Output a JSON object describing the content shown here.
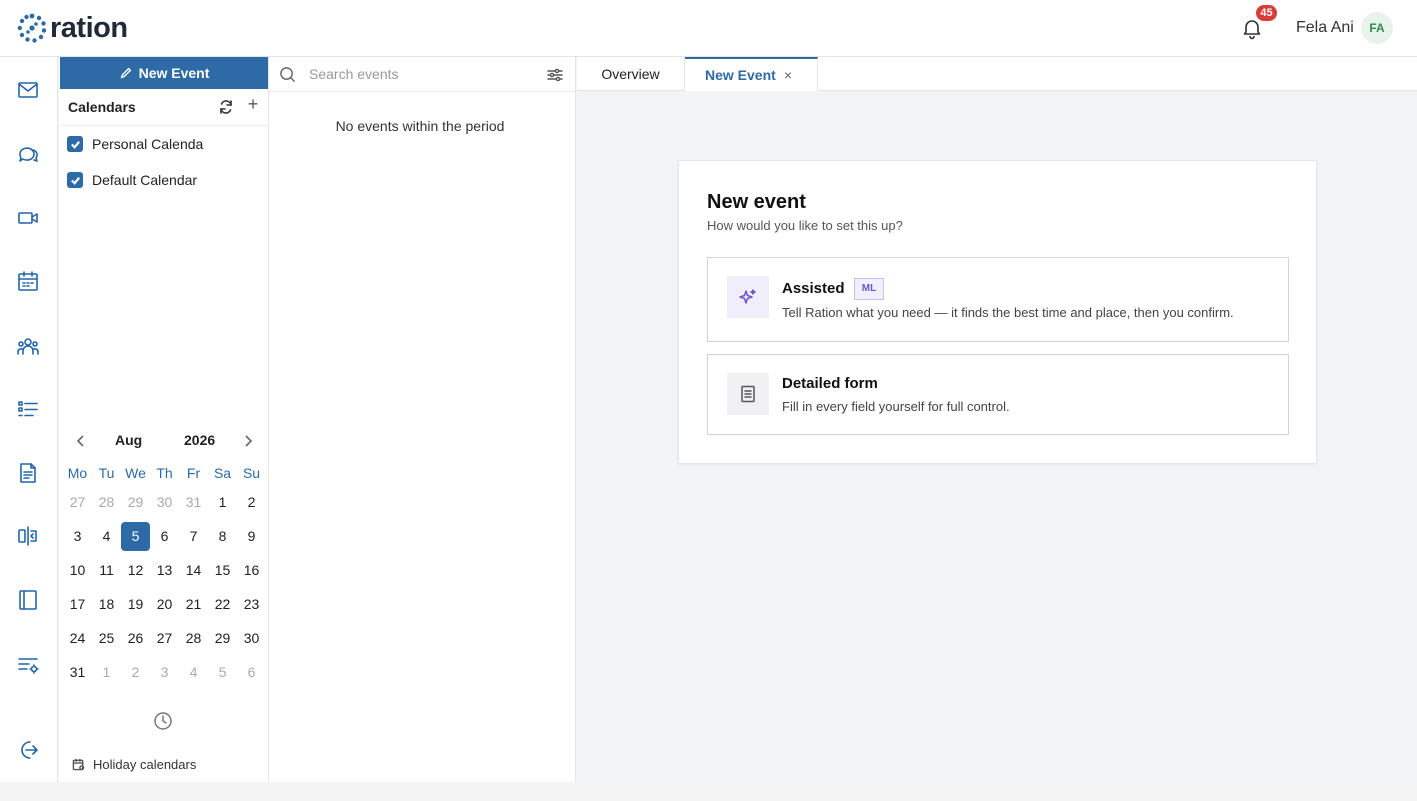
{
  "app": {
    "brand": "ration",
    "brand_color": "#2d6aa6"
  },
  "header": {
    "notifications_count": "45",
    "user_name": "Fela Ani",
    "user_initials": "FA"
  },
  "rail": {
    "icons": [
      "mail-icon",
      "chat-icon",
      "video-icon",
      "calendar-icon",
      "people-icon",
      "tasks-icon",
      "document-icon",
      "compare-icon",
      "notebook-icon",
      "settings-list-icon",
      "logout-icon"
    ]
  },
  "calendars": {
    "new_event_label": "New Event",
    "heading": "Calendars",
    "items": [
      {
        "label": "Personal Calenda",
        "checked": true
      },
      {
        "label": "Default Calendar",
        "checked": true
      }
    ],
    "holiday_label": "Holiday calendars"
  },
  "minical": {
    "month": "Aug",
    "year": "2026",
    "dow": [
      "Mo",
      "Tu",
      "We",
      "Th",
      "Fr",
      "Sa",
      "Su"
    ],
    "selected_day": "5",
    "days": [
      [
        "27",
        "out"
      ],
      [
        "28",
        "out"
      ],
      [
        "29",
        "out"
      ],
      [
        "30",
        "out"
      ],
      [
        "31",
        "out"
      ],
      [
        "1",
        ""
      ],
      [
        "2",
        ""
      ],
      [
        "3",
        ""
      ],
      [
        "4",
        ""
      ],
      [
        "5",
        "sel"
      ],
      [
        "6",
        ""
      ],
      [
        "7",
        ""
      ],
      [
        "8",
        ""
      ],
      [
        "9",
        ""
      ],
      [
        "10",
        ""
      ],
      [
        "11",
        ""
      ],
      [
        "12",
        ""
      ],
      [
        "13",
        ""
      ],
      [
        "14",
        ""
      ],
      [
        "15",
        ""
      ],
      [
        "16",
        ""
      ],
      [
        "17",
        ""
      ],
      [
        "18",
        ""
      ],
      [
        "19",
        ""
      ],
      [
        "20",
        ""
      ],
      [
        "21",
        ""
      ],
      [
        "22",
        ""
      ],
      [
        "23",
        ""
      ],
      [
        "24",
        ""
      ],
      [
        "25",
        ""
      ],
      [
        "26",
        ""
      ],
      [
        "27",
        ""
      ],
      [
        "28",
        ""
      ],
      [
        "29",
        ""
      ],
      [
        "30",
        ""
      ],
      [
        "31",
        ""
      ],
      [
        "1",
        "out"
      ],
      [
        "2",
        "out"
      ],
      [
        "3",
        "out"
      ],
      [
        "4",
        "out"
      ],
      [
        "5",
        "out"
      ],
      [
        "6",
        "out"
      ]
    ]
  },
  "eventlist": {
    "search_placeholder": "Search events",
    "empty_message": "No events within the period"
  },
  "tabs": [
    {
      "label": "Overview",
      "active": false
    },
    {
      "label": "New Event",
      "active": true,
      "close": "×"
    }
  ],
  "new_event_card": {
    "title": "New event",
    "subtitle": "How would you like to set this up?",
    "options": [
      {
        "title": "Assisted",
        "badge": "ML",
        "description": "Tell Ration what you need — it finds the best time and place, then you confirm."
      },
      {
        "title": "Detailed form",
        "description": "Fill in every field yourself for full control."
      }
    ]
  }
}
